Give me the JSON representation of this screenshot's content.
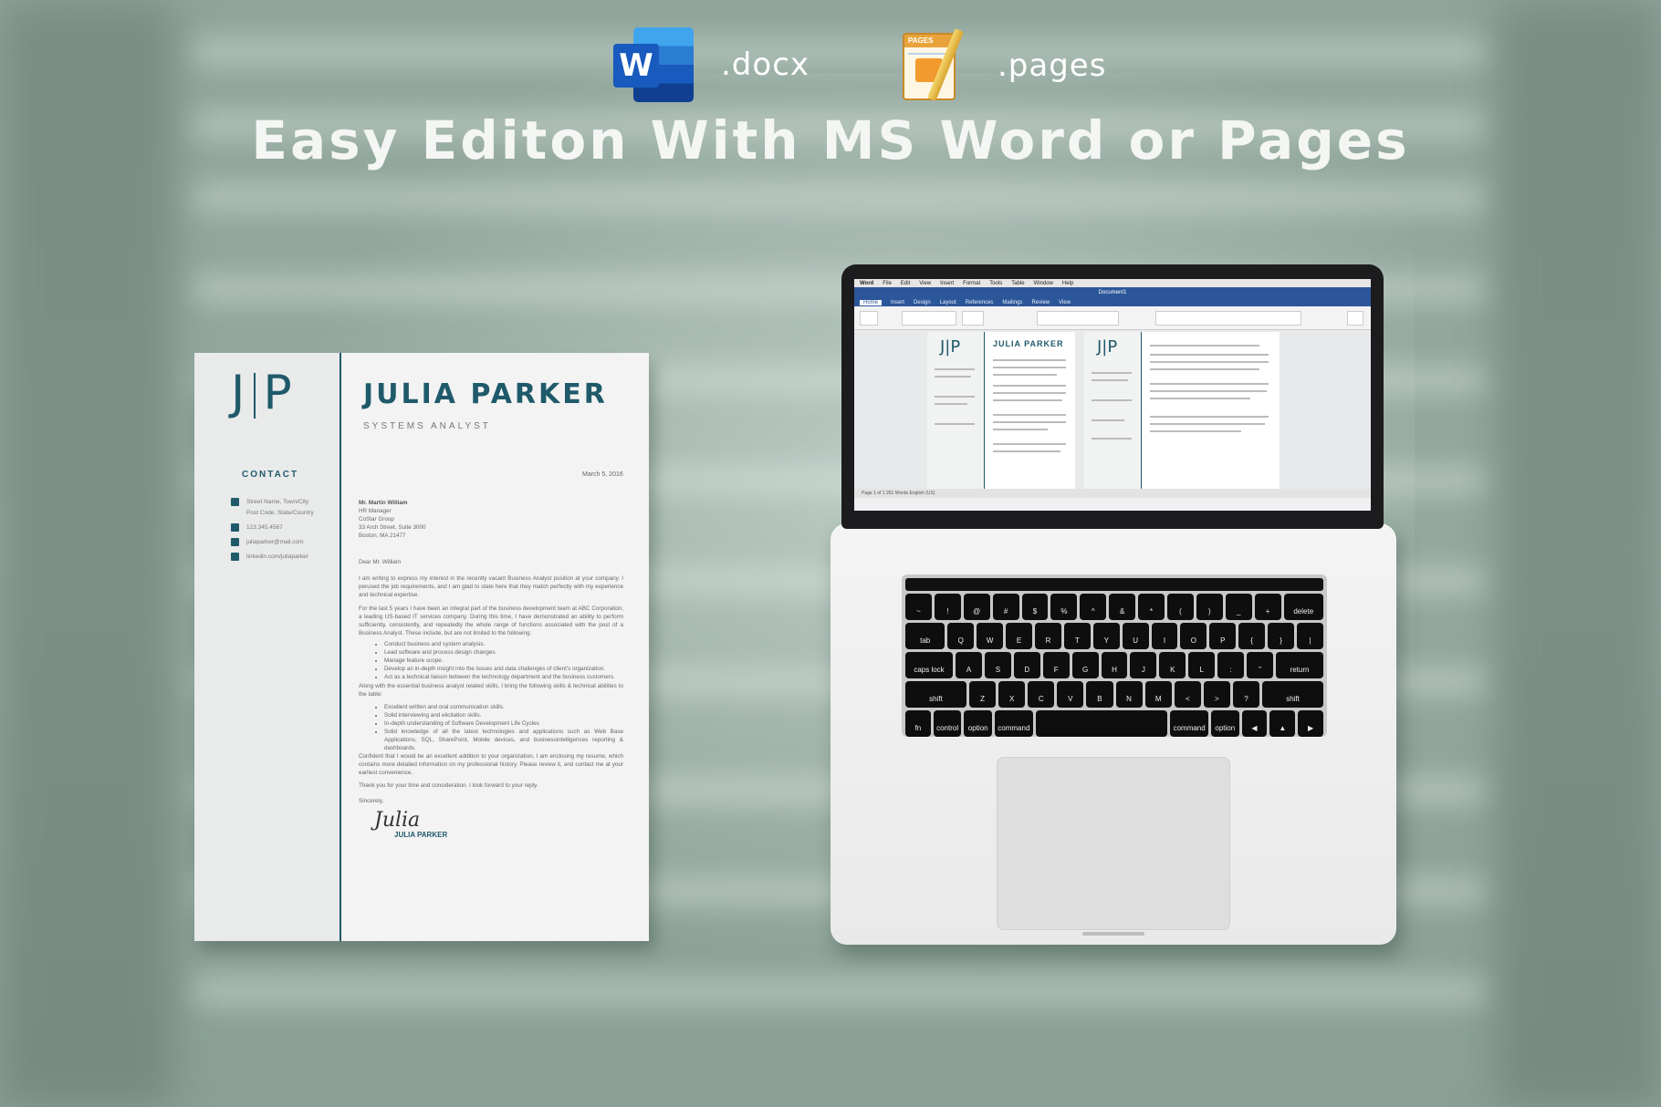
{
  "header": {
    "formats": [
      {
        "icon": "word-icon",
        "label": ".docx"
      },
      {
        "icon": "pages-icon",
        "label": ".pages"
      }
    ],
    "headline": "Easy Editon With MS Word or Pages"
  },
  "letter": {
    "monogram_left": "J",
    "monogram_right": "P",
    "name": "JULIA PARKER",
    "role": "SYSTEMS ANALYST",
    "contact_heading": "CONTACT",
    "contact": [
      {
        "icon": "home-icon",
        "text": "Street Name, Town/City"
      },
      {
        "icon": "",
        "text": "Post Code, State/Country"
      },
      {
        "icon": "phone-icon",
        "text": "123.345.4567"
      },
      {
        "icon": "email-icon",
        "text": "juliaparker@mail.com"
      },
      {
        "icon": "linkedin-icon",
        "text": "linkedin.com/juliaparker"
      }
    ],
    "date": "March 5, 2016",
    "recipient": [
      "Mr. Martin William",
      "HR Manager",
      "CoStar Group",
      "33 Arch Street, Suite 3000",
      "Boston, MA 21477"
    ],
    "salutation": "Dear Mr. William",
    "p1": "I am writing to express my interest in the recently vacant Business Analyst position at your company. I perused the job requirements, and I am glad to state here that they match perfectly with my experience and technical expertise.",
    "p2": "For the last 5 years I have been an integral part of the business development team at ABC Corporation, a leading US-based IT services company. During this time, I have demonstrated an ability to perform sufficiently, consistently, and repeatedly the whole range of functions associated with the post of a Business Analyst. These include, but are not limited to the following:",
    "list1": [
      "Conduct business and system analysis.",
      "Lead software and process design changes.",
      "Manage feature scope.",
      "Develop an in-depth insight into the issues and data challenges of client's organization.",
      "Act as a technical liaison between the technology department and the business customers."
    ],
    "p3": "Along with the essential business analyst related skills, I bring the following skills & technical abilities to the table:",
    "list2": [
      "Excellent written and oral communication skills.",
      "Solid interviewing and elicitation skills.",
      "In-depth understanding of Software Development Life Cycles",
      "Solid knowledge of all the latest technologies and applications such as Web Base Applications, SQL, SharePoint, Mobile devices, and businessintelligences reporting & dashboards."
    ],
    "p4": "Confident that I would be an excellent addition to your organization, I am enclosing my resume, which contains more detailed information on my professional history. Please review it, and contact me at your earliest convenience.",
    "p5": "Thank you for your time and consideration. I look forward to your reply.",
    "closing": "Sincerely,",
    "signature": "Julia",
    "signature_name": "JULIA PARKER"
  },
  "laptop": {
    "menu": [
      "Word",
      "File",
      "Edit",
      "View",
      "Insert",
      "Format",
      "Tools",
      "Table",
      "Window",
      "Help"
    ],
    "doc_title": "Document1",
    "ribbon_tabs": [
      "Home",
      "Insert",
      "Design",
      "Layout",
      "References",
      "Mailings",
      "Review",
      "View"
    ],
    "doc_name": "JULIA PARKER",
    "status": "Page 1 of 1    261 Words    English (US)",
    "keys": {
      "row1": [
        "~",
        "!",
        "@",
        "#",
        "$",
        "%",
        "^",
        "&",
        "*",
        "(",
        ")",
        "_",
        "+",
        "delete"
      ],
      "row2": [
        "tab",
        "Q",
        "W",
        "E",
        "R",
        "T",
        "Y",
        "U",
        "I",
        "O",
        "P",
        "{",
        "}",
        "|"
      ],
      "row3": [
        "caps lock",
        "A",
        "S",
        "D",
        "F",
        "G",
        "H",
        "J",
        "K",
        "L",
        ":",
        "\"",
        "return"
      ],
      "row4": [
        "shift",
        "Z",
        "X",
        "C",
        "V",
        "B",
        "N",
        "M",
        "<",
        ">",
        "?",
        "shift"
      ],
      "row5": [
        "fn",
        "control",
        "option",
        "command",
        "",
        "command",
        "option",
        "◀",
        "▲",
        "▶"
      ]
    }
  }
}
